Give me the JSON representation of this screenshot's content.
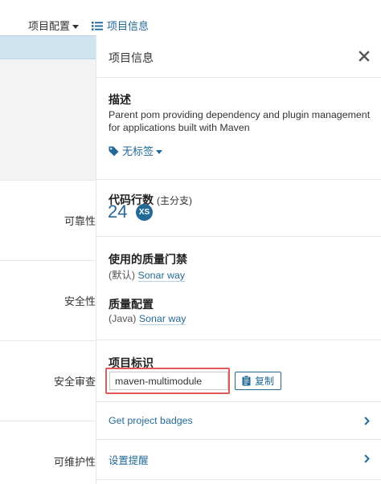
{
  "topbar": {
    "config_menu": "项目配置",
    "info_link": "项目信息"
  },
  "left_rows": [
    "可靠性",
    "安全性",
    "安全审查",
    "可维护性"
  ],
  "panel": {
    "title": "项目信息",
    "close_icon": "close-icon",
    "description": {
      "heading": "描述",
      "text": "Parent pom providing dependency and plugin management for applications built with Maven",
      "tags_label": "无标签"
    },
    "lines_of_code": {
      "heading": "代码行数",
      "subtitle": "(主分支)",
      "value": "24",
      "size_badge": "XS"
    },
    "quality_gate": {
      "heading": "使用的质量门禁",
      "prefix": "(默认)",
      "link": "Sonar way"
    },
    "quality_profile": {
      "heading": "质量配置",
      "prefix": "(Java)",
      "link": "Sonar way"
    },
    "project_key": {
      "heading": "项目标识",
      "value": "maven-multimodule",
      "copy_label": "复制"
    },
    "badges_link": "Get project badges",
    "notifications_link": "设置提醒"
  },
  "colors": {
    "link": "#236a97",
    "highlight": "#e05a5a",
    "selected_row": "#cfe3f1"
  }
}
